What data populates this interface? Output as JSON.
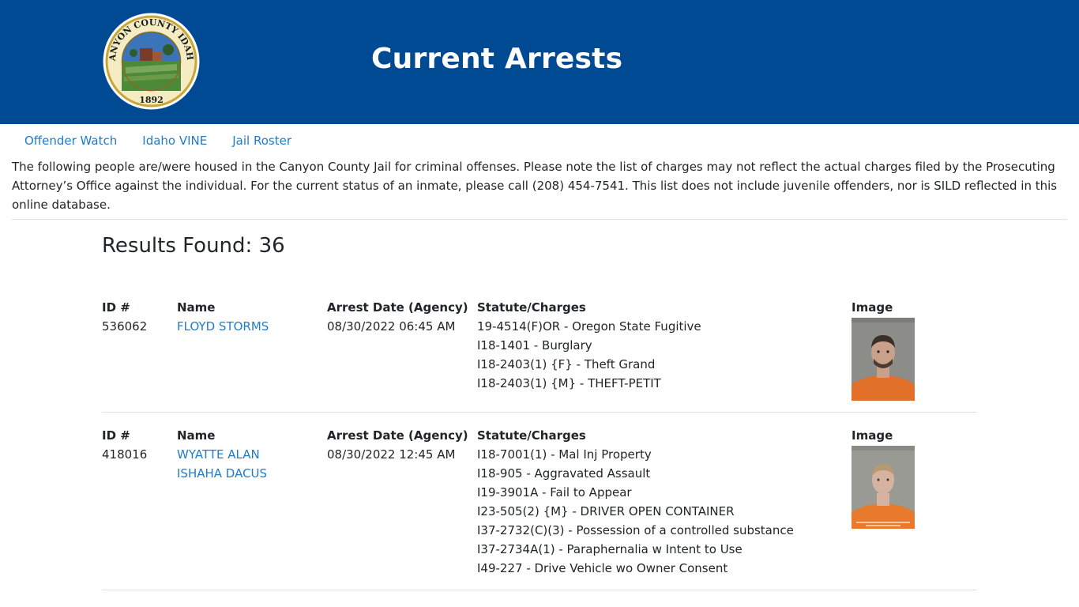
{
  "header": {
    "title": "Current Arrests",
    "seal": {
      "top_text": "CANYON COUNTY IDAHO",
      "year": "1892",
      "colors": {
        "ring": "#c9a63b",
        "inner": "#f5ecc4",
        "sky": "#3b74b8"
      }
    },
    "bg_color": "#004a93"
  },
  "nav": {
    "links": [
      "Offender Watch",
      "Idaho VINE",
      "Jail Roster"
    ]
  },
  "intro": {
    "text": "The following people are/were housed in the Canyon County Jail for criminal offenses. Please note the list of charges may not reflect the actual charges filed by the Prosecuting Attorney’s Office against the individual. For the current status of an inmate, please call (208) 454-7541. This list does not include juvenile offenders, nor is SILD reflected in this online database."
  },
  "results": {
    "label": "Results Found: 36"
  },
  "columns": {
    "id": "ID #",
    "name": "Name",
    "arrest_date": "Arrest Date (Agency)",
    "charges": "Statute/Charges",
    "image": "Image"
  },
  "records": [
    {
      "id": "536062",
      "name_lines": [
        "FLOYD STORMS"
      ],
      "arrest_date": "08/30/2022 06:45 AM",
      "charges": [
        "19-4514(F)OR - Oregon State Fugitive",
        "I18-1401 - Burglary",
        "I18-2403(1) {F} - Theft Grand",
        "I18-2403(1) {M} - THEFT-PETIT"
      ],
      "mugshot_colors": {
        "bg": "#8c8c88",
        "shirt": "#e0702a",
        "skin": "#c9a08a",
        "hair": "#3a2e28"
      }
    },
    {
      "id": "418016",
      "name_lines": [
        "WYATTE ALAN",
        "ISHAHA DACUS"
      ],
      "arrest_date": "08/30/2022 12:45 AM",
      "charges": [
        "I18-7001(1) - Mal Inj Property",
        "I18-905 - Aggravated Assault",
        "I19-3901A - Fail to Appear",
        "I23-505(2) {M} - DRIVER OPEN CONTAINER",
        "I37-2732(C)(3) - Possession of a controlled substance",
        "I37-2734A(1) - Paraphernalia w Intent to Use",
        "I49-227 - Drive Vehicle wo Owner Consent"
      ],
      "mugshot_colors": {
        "bg": "#9a9a94",
        "shirt": "#e87a2e",
        "skin": "#d6b3a0",
        "hair": "#b89a72"
      }
    }
  ]
}
